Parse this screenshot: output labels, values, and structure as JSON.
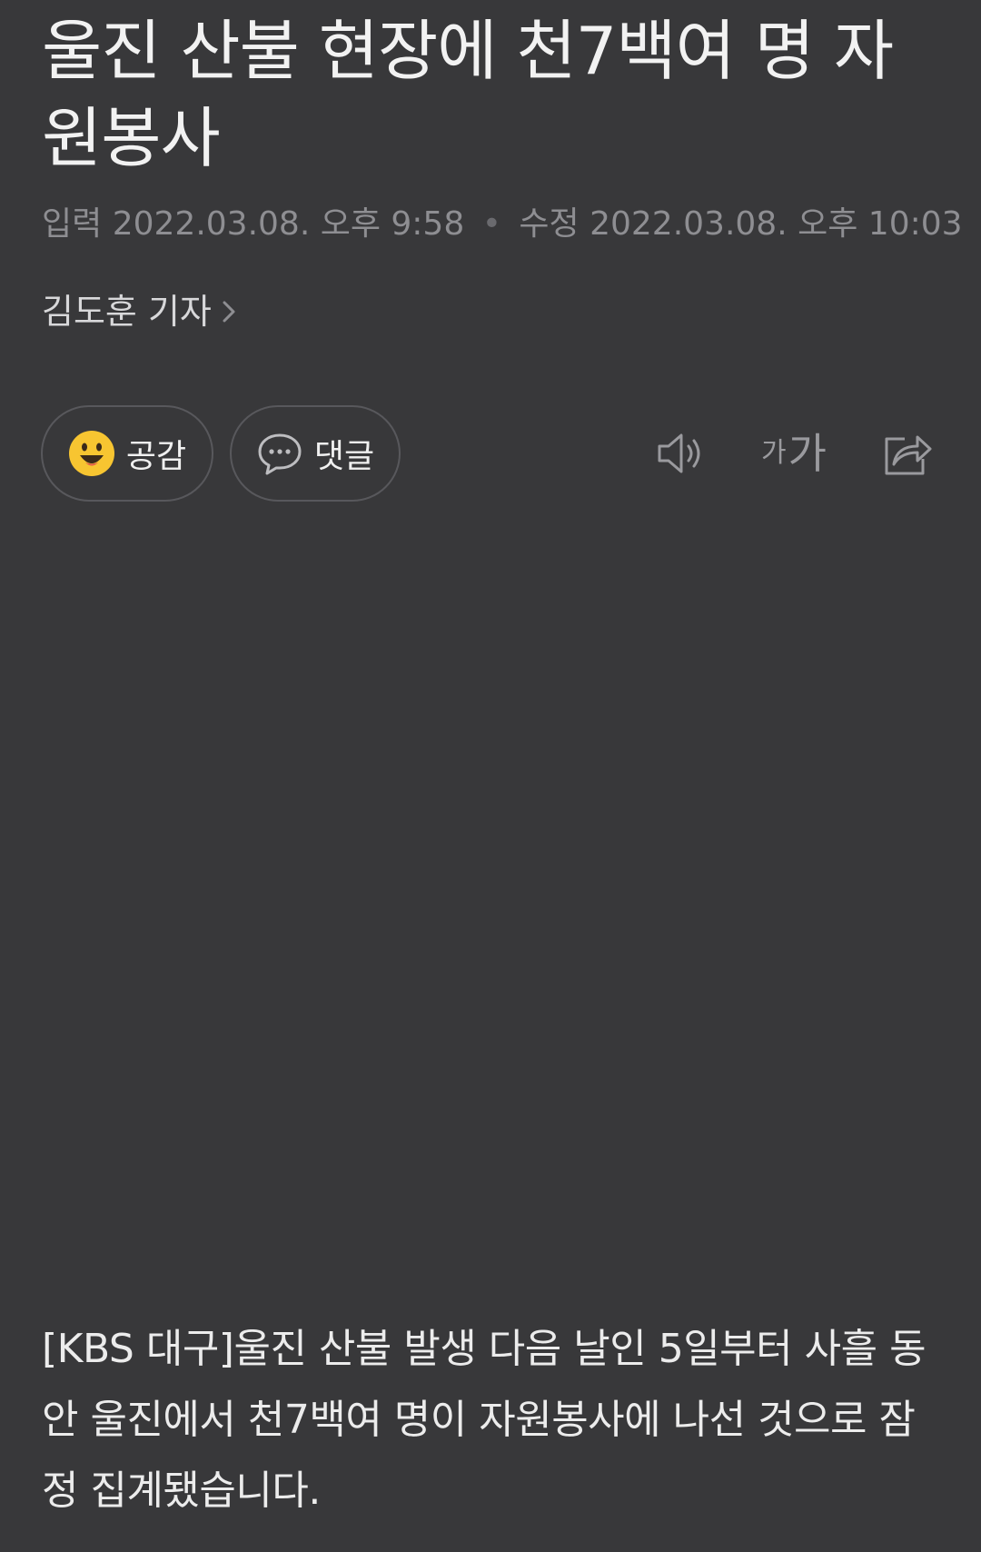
{
  "article": {
    "title": "울진 산불 현장에 천7백여 명 자원봉사",
    "published_label": "입력",
    "published": "2022.03.08. 오후 9:58",
    "separator": "•",
    "updated_label": "수정",
    "updated": "2022.03.08. 오후 10:03",
    "reporter": "김도훈 기자",
    "body": "[KBS 대구]울진 산불 발생 다음 날인 5일부터 사흘 동안 울진에서 천7백여 명이 자원봉사에 나선 것으로 잠정 집계됐습니다."
  },
  "actions": {
    "like_label": "공감",
    "comment_label": "댓글",
    "font_small": "가",
    "font_big": "가"
  },
  "icons": {
    "like": "smiley-icon",
    "comment": "speech-bubble-icon",
    "speak": "speaker-icon",
    "share": "share-icon",
    "reporter_link": "chevron-right-icon"
  },
  "colors": {
    "background": "#38383a",
    "emoji_yellow": "#f7c531"
  }
}
